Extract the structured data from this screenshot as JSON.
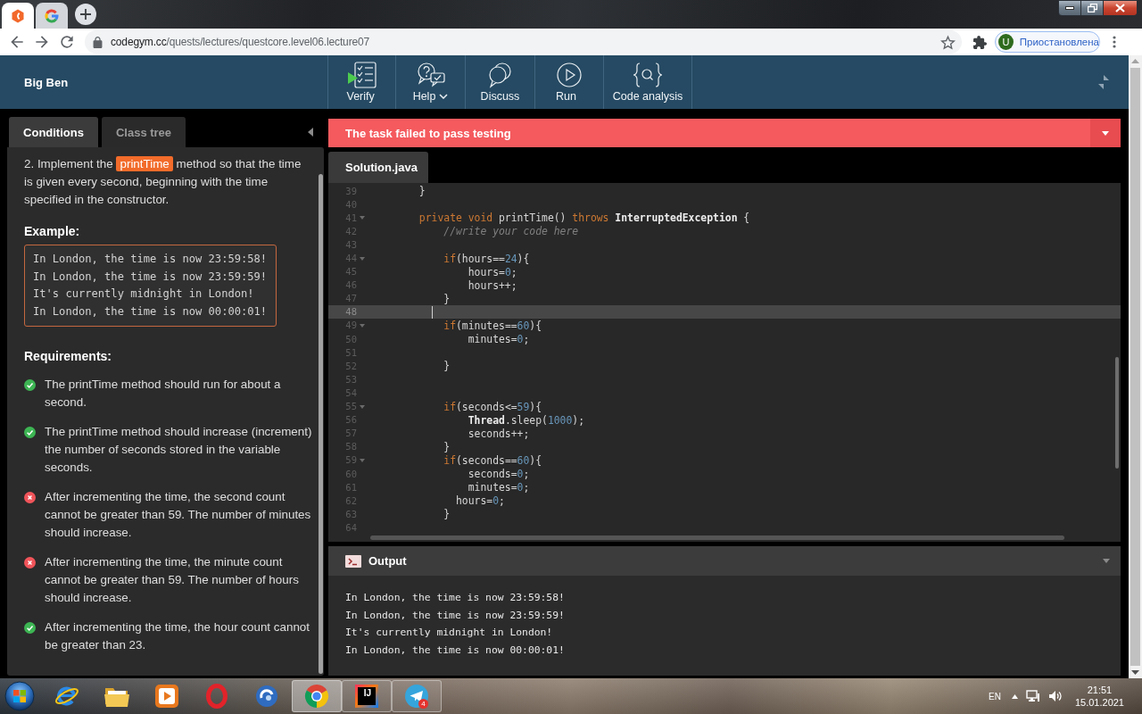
{
  "browser": {
    "tabs": [
      {
        "selected": true
      },
      {
        "selected": false
      }
    ],
    "url": {
      "host": "codegym.cc",
      "path": "/quests/lectures/questcore.level06.lecture07"
    },
    "profile": {
      "initial": "U",
      "status": "Приостановлена"
    }
  },
  "header": {
    "title": "Big Ben",
    "tools": [
      {
        "kind": "verify",
        "label": "Verify",
        "dropdown": false
      },
      {
        "kind": "help",
        "label": "Help",
        "dropdown": true
      },
      {
        "kind": "discuss",
        "label": "Discuss",
        "dropdown": false
      },
      {
        "kind": "run",
        "label": "Run",
        "dropdown": false
      },
      {
        "kind": "analysis",
        "label": "Code analysis",
        "dropdown": false
      }
    ]
  },
  "conditions": {
    "tabs": [
      {
        "label": "Conditions",
        "selected": true
      },
      {
        "label": "Class tree",
        "selected": false
      }
    ],
    "task": {
      "before": "2. Implement the",
      "code": "printTime",
      "after": "method so that the time is given every second, beginning with the time specified in the constructor."
    },
    "example_title": "Example:",
    "example_lines": [
      "In London, the time is now 23:59:58!",
      "In London, the time is now 23:59:59!",
      "It's currently midnight in London!",
      "In London, the time is now 00:00:01!"
    ],
    "requirements_title": "Requirements:",
    "requirements": [
      {
        "text": "The printTime method should run for about a second.",
        "passed": true
      },
      {
        "text": "The printTime method should increase (increment) the number of seconds stored in the variable seconds.",
        "passed": true
      },
      {
        "text": "After incrementing the time, the second count cannot be greater than 59. The number of minutes should increase.",
        "passed": false
      },
      {
        "text": "After incrementing the time, the minute count cannot be greater than 59. The number of hours should increase.",
        "passed": false
      },
      {
        "text": "After incrementing the time, the hour count cannot be greater than 23.",
        "passed": true
      }
    ]
  },
  "result": {
    "passed": false,
    "message": "The task failed to pass testing"
  },
  "editor": {
    "tab": "Solution.java",
    "lines": [
      {
        "number": "39",
        "fold": false,
        "current": false,
        "tokens": [
          {
            "kind": "plain",
            "text": "        }"
          }
        ]
      },
      {
        "number": "40",
        "fold": false,
        "current": false
      },
      {
        "number": "41",
        "fold": true,
        "current": false,
        "tokens": [
          {
            "kind": "keyword",
            "text": "        private void"
          },
          {
            "kind": "plain",
            "text": " printTime() "
          },
          {
            "kind": "keyword",
            "text": "throws "
          },
          {
            "kind": "type",
            "text": "InterruptedException"
          },
          {
            "kind": "plain",
            "text": " {"
          }
        ]
      },
      {
        "number": "42",
        "fold": false,
        "current": false,
        "tokens": [
          {
            "kind": "comment",
            "text": "            //write your code here"
          }
        ]
      },
      {
        "number": "43",
        "fold": false,
        "current": false
      },
      {
        "number": "44",
        "fold": true,
        "current": false,
        "tokens": [
          {
            "kind": "keyword",
            "text": "            if"
          },
          {
            "kind": "plain",
            "text": "(hours=="
          },
          {
            "kind": "number",
            "text": "24"
          },
          {
            "kind": "plain",
            "text": "){"
          }
        ]
      },
      {
        "number": "45",
        "fold": false,
        "current": false,
        "tokens": [
          {
            "kind": "plain",
            "text": "                hours="
          },
          {
            "kind": "number",
            "text": "0"
          },
          {
            "kind": "plain",
            "text": ";"
          }
        ]
      },
      {
        "number": "46",
        "fold": false,
        "current": false,
        "tokens": [
          {
            "kind": "plain",
            "text": "                hours++;"
          }
        ]
      },
      {
        "number": "47",
        "fold": false,
        "current": false,
        "tokens": [
          {
            "kind": "plain",
            "text": "            }"
          }
        ]
      },
      {
        "number": "48",
        "fold": false,
        "current": true
      },
      {
        "number": "49",
        "fold": true,
        "current": false,
        "tokens": [
          {
            "kind": "keyword",
            "text": "            if"
          },
          {
            "kind": "plain",
            "text": "(minutes=="
          },
          {
            "kind": "number",
            "text": "60"
          },
          {
            "kind": "plain",
            "text": "){"
          }
        ]
      },
      {
        "number": "50",
        "fold": false,
        "current": false,
        "tokens": [
          {
            "kind": "plain",
            "text": "                minutes="
          },
          {
            "kind": "number",
            "text": "0"
          },
          {
            "kind": "plain",
            "text": ";"
          }
        ]
      },
      {
        "number": "51",
        "fold": false,
        "current": false
      },
      {
        "number": "52",
        "fold": false,
        "current": false,
        "tokens": [
          {
            "kind": "plain",
            "text": "            }"
          }
        ]
      },
      {
        "number": "53",
        "fold": false,
        "current": false
      },
      {
        "number": "54",
        "fold": false,
        "current": false
      },
      {
        "number": "55",
        "fold": true,
        "current": false,
        "tokens": [
          {
            "kind": "keyword",
            "text": "            if"
          },
          {
            "kind": "plain",
            "text": "(seconds<="
          },
          {
            "kind": "number",
            "text": "59"
          },
          {
            "kind": "plain",
            "text": "){"
          }
        ]
      },
      {
        "number": "56",
        "fold": false,
        "current": false,
        "tokens": [
          {
            "kind": "type",
            "text": "                Thread"
          },
          {
            "kind": "plain",
            "text": ".sleep("
          },
          {
            "kind": "number",
            "text": "1000"
          },
          {
            "kind": "plain",
            "text": ");"
          }
        ]
      },
      {
        "number": "57",
        "fold": false,
        "current": false,
        "tokens": [
          {
            "kind": "plain",
            "text": "                seconds++;"
          }
        ]
      },
      {
        "number": "58",
        "fold": false,
        "current": false,
        "tokens": [
          {
            "kind": "plain",
            "text": "            }"
          }
        ]
      },
      {
        "number": "59",
        "fold": true,
        "current": false,
        "tokens": [
          {
            "kind": "keyword",
            "text": "            if"
          },
          {
            "kind": "plain",
            "text": "(seconds=="
          },
          {
            "kind": "number",
            "text": "60"
          },
          {
            "kind": "plain",
            "text": "){"
          }
        ]
      },
      {
        "number": "60",
        "fold": false,
        "current": false,
        "tokens": [
          {
            "kind": "plain",
            "text": "                seconds="
          },
          {
            "kind": "number",
            "text": "0"
          },
          {
            "kind": "plain",
            "text": ";"
          }
        ]
      },
      {
        "number": "61",
        "fold": false,
        "current": false,
        "tokens": [
          {
            "kind": "plain",
            "text": "                minutes="
          },
          {
            "kind": "number",
            "text": "0"
          },
          {
            "kind": "plain",
            "text": ";"
          }
        ]
      },
      {
        "number": "62",
        "fold": false,
        "current": false,
        "tokens": [
          {
            "kind": "plain",
            "text": "              hours="
          },
          {
            "kind": "number",
            "text": "0"
          },
          {
            "kind": "plain",
            "text": ";"
          }
        ]
      },
      {
        "number": "63",
        "fold": false,
        "current": false,
        "tokens": [
          {
            "kind": "plain",
            "text": "            }"
          }
        ]
      },
      {
        "number": "64",
        "fold": false,
        "current": false
      }
    ]
  },
  "output": {
    "title": "Output",
    "lines": [
      "In London, the time is now 23:59:58!",
      "In London, the time is now 23:59:59!",
      "It's currently midnight in London!",
      "In London, the time is now 00:00:01!"
    ]
  },
  "taskbar": {
    "apps": [
      {
        "running": false,
        "selected": false
      },
      {
        "running": false,
        "selected": false
      },
      {
        "running": false,
        "selected": false
      },
      {
        "running": false,
        "selected": false
      },
      {
        "running": false,
        "selected": false
      },
      {
        "running": true,
        "selected": true
      },
      {
        "running": true,
        "selected": false,
        "logo_text": "IJ"
      },
      {
        "running": true,
        "selected": false,
        "badge": "4"
      }
    ],
    "language": "EN",
    "time": "21:51",
    "date": "15.01.2021"
  }
}
